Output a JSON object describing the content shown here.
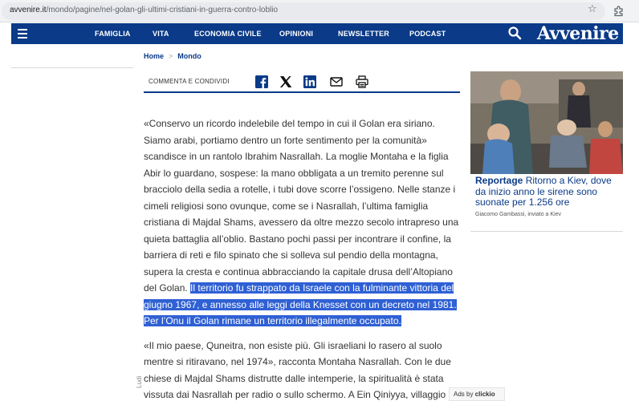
{
  "browser": {
    "url_host": "avvenire.it",
    "url_path": "/mondo/pagine/nel-golan-gli-ultimi-cristiani-in-guerra-contro-loblio"
  },
  "nav": {
    "items": [
      "FAMIGLIA",
      "VITA",
      "ECONOMIA CIVILE",
      "OPINIONI",
      "NEWSLETTER",
      "PODCAST"
    ],
    "logo": "Avvenire",
    "brand_color": "#0a3a88"
  },
  "breadcrumb": {
    "home": "Home",
    "sep": ">",
    "section": "Mondo"
  },
  "share": {
    "label": "COMMENTA E CONDIVIDI"
  },
  "article": {
    "p1_plain": "«Conservo un ricordo indelebile del tempo in cui il Golan era siriano. Siamo arabi, portiamo dentro un forte sentimento per la comunità» scandisce in un rantolo Ibrahim Nasrallah. La moglie Montaha e la figlia Abir lo guardano, sospese: la mano obbligata a un tremito perenne sul bracciolo della sedia a rotelle, i tubi dove scorre l’ossigeno. Nelle stanze i cimeli religiosi sono ovunque, come se i Nasrallah, l’ultima famiglia cristiana di Majdal Shams, avessero da oltre mezzo secolo intrapreso una quieta battaglia all’oblio. Bastano pochi passi per incontrare il confine, la barriera di reti e filo spinato che si solleva sul pendio della montagna, supera la cresta e continua abbracciando la capitale drusa dell’Altopiano del Golan.",
    "p1_highlight": "Il territorio fu strappato da Israele con la fulminante vittoria del giugno 1967, e annesso alle leggi della Knesset con un decreto nel 1981. Per l’Onu il Golan rimane un territorio illegalmente occupato.",
    "p2": "«Il mio paese, Quneitra, non esiste più. Gli israeliani lo rasero al suolo mentre si ritiravano, nel 1974», racconta Montaha Nasrallah. Con le due chiese di Majdal Shams distrutte dalle intemperie, la spiritualità è stata vissuta dai Nasrallah per radio o sullo schermo. A Ein Qiniyya, villaggio"
  },
  "rail": {
    "kicker": "Reportage",
    "headline": "Ritorno a Kiev, dove da inizio anno le sirene sono suonate per 1.256 ore",
    "byline": "Giacomo Gambassi, inviato a Kiev"
  },
  "side_label": "Ludi",
  "ads": {
    "prefix": "Ads by",
    "brand": "clickio"
  }
}
